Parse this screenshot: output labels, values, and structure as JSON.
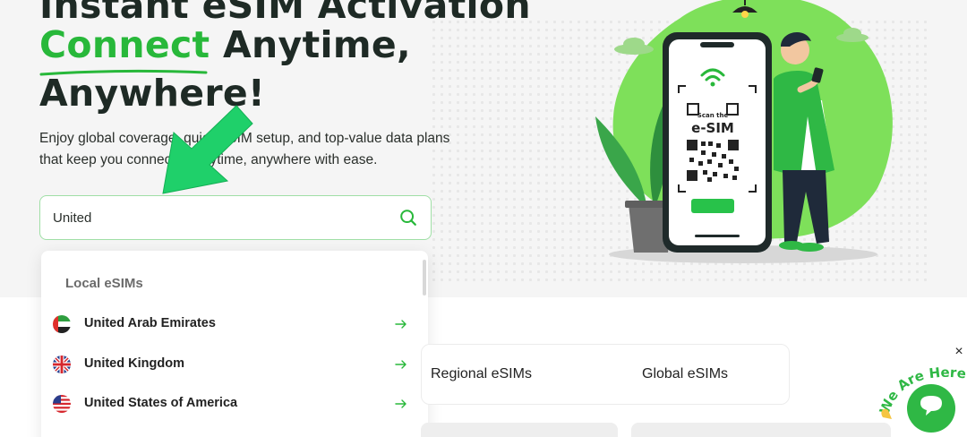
{
  "hero": {
    "title_line1": "Instant eSIM Activation",
    "title_line2_accent": "Connect",
    "title_line2_rest": " Anytime,",
    "title_line3": "Anywhere!",
    "description": "Enjoy global coverage, quick eSIM setup, and top-value data plans that keep you connected anytime, anywhere with ease."
  },
  "search": {
    "value": "United",
    "icon": "search-icon"
  },
  "dropdown": {
    "section_title": "Local eSIMs",
    "countries": [
      {
        "name": "United Arab Emirates",
        "flag": "uae-flag-icon"
      },
      {
        "name": "United Kingdom",
        "flag": "uk-flag-icon"
      },
      {
        "name": "United States of America",
        "flag": "usa-flag-icon"
      }
    ]
  },
  "tabs": {
    "regional": "Regional eSIMs",
    "global": "Global eSIMs"
  },
  "illustration": {
    "scan_text": "Scan the",
    "esim_text": "e-SIM"
  },
  "chat": {
    "label": "We Are Here!",
    "close": "×"
  },
  "colors": {
    "brand_green": "#28b83a",
    "light_green": "#7ee05a"
  }
}
